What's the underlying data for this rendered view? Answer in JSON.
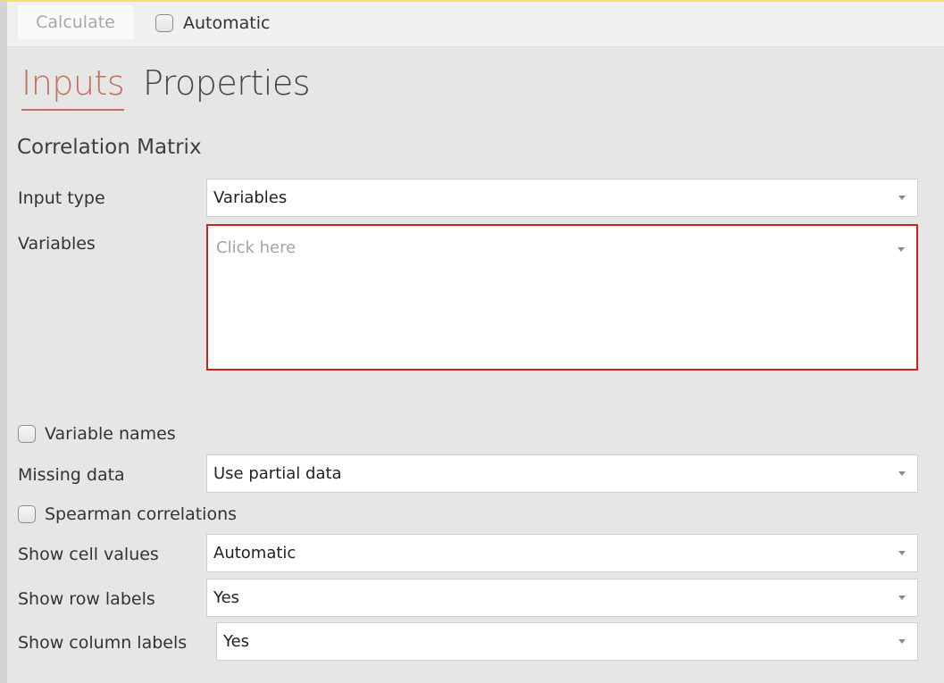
{
  "toolbar": {
    "calculate_label": "Calculate",
    "automatic_label": "Automatic",
    "automatic_checked": false
  },
  "tabs": [
    {
      "label": "Inputs",
      "active": true
    },
    {
      "label": "Properties",
      "active": false
    }
  ],
  "section_title": "Correlation Matrix",
  "fields": {
    "input_type": {
      "label": "Input type",
      "value": "Variables"
    },
    "variables": {
      "label": "Variables",
      "placeholder": "Click here"
    },
    "variable_names": {
      "label": "Variable names",
      "checked": false
    },
    "missing_data": {
      "label": "Missing data",
      "value": "Use partial data"
    },
    "spearman": {
      "label": "Spearman correlations",
      "checked": false
    },
    "show_cell_values": {
      "label": "Show cell values",
      "value": "Automatic"
    },
    "show_row_labels": {
      "label": "Show row labels",
      "value": "Yes"
    },
    "show_column_labels": {
      "label": "Show column labels",
      "value": "Yes"
    }
  },
  "colors": {
    "active_tab": "#c0705c",
    "error_border": "#cc2222",
    "top_accent": "#f3df6a"
  },
  "icons": {
    "dropdown": "chevron-down-icon",
    "checkbox": "checkbox-unchecked-icon"
  }
}
